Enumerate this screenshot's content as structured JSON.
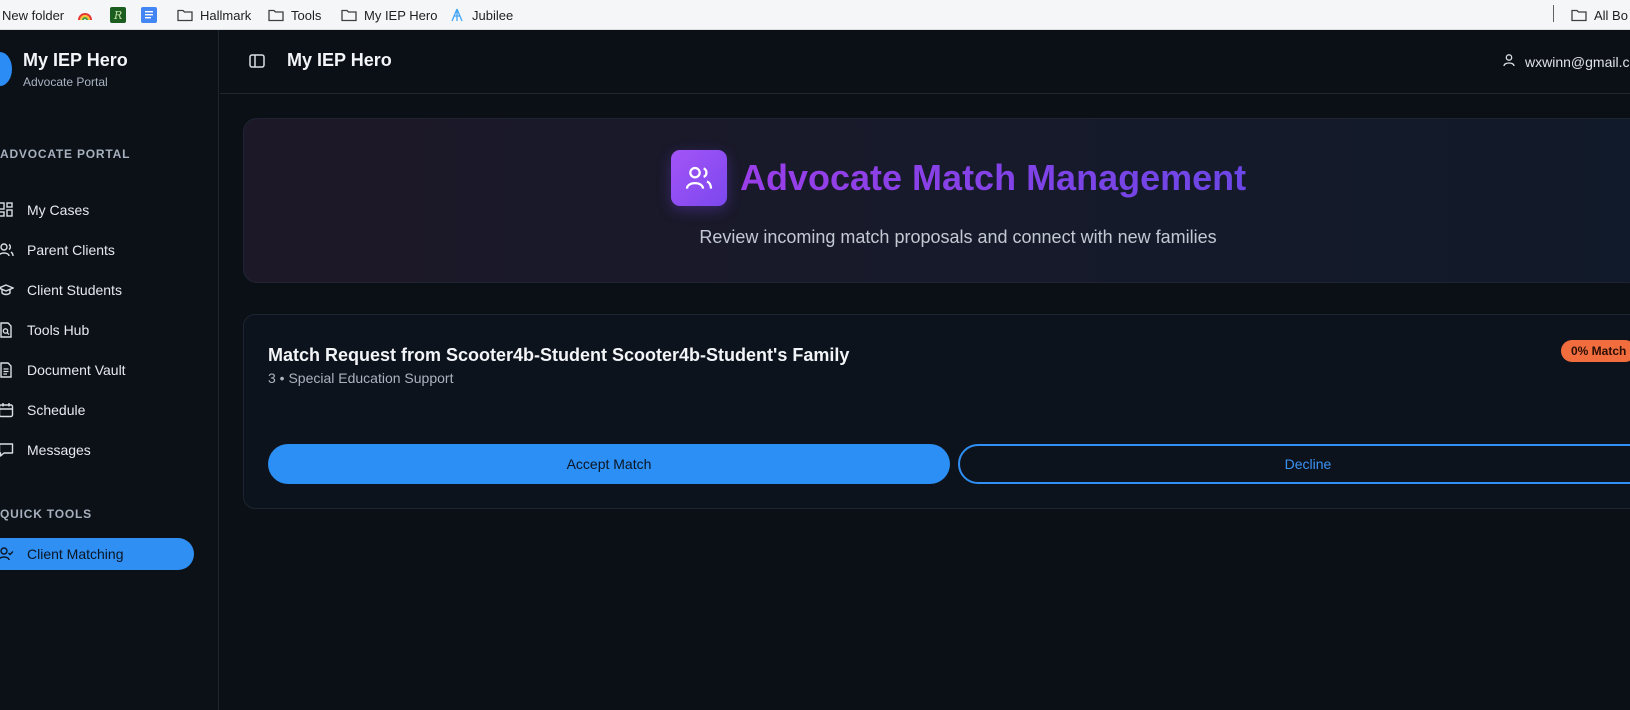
{
  "bookmarks": {
    "items": [
      {
        "label": "New folder",
        "icon": "folder-icon"
      },
      {
        "label": "",
        "icon": "rainbow-icon"
      },
      {
        "label": "",
        "icon": "r-logo-icon"
      },
      {
        "label": "",
        "icon": "docs-icon"
      },
      {
        "label": "Hallmark",
        "icon": "folder-icon"
      },
      {
        "label": "Tools",
        "icon": "folder-icon"
      },
      {
        "label": "My IEP Hero",
        "icon": "folder-icon"
      },
      {
        "label": "Jubilee",
        "icon": "jubilee-icon"
      },
      {
        "label": "All Bo",
        "icon": "folder-icon"
      }
    ]
  },
  "sidebar": {
    "brand_title": "My IEP Hero",
    "brand_subtitle": "Advocate Portal",
    "section_advocate": "ADVOCATE PORTAL",
    "items": [
      {
        "label": "My Cases",
        "icon": "grid-icon"
      },
      {
        "label": "Parent Clients",
        "icon": "users-icon"
      },
      {
        "label": "Client Students",
        "icon": "graduation-cap-icon"
      },
      {
        "label": "Tools Hub",
        "icon": "file-search-icon"
      },
      {
        "label": "Document Vault",
        "icon": "document-icon"
      },
      {
        "label": "Schedule",
        "icon": "calendar-icon"
      },
      {
        "label": "Messages",
        "icon": "message-icon"
      }
    ],
    "section_quick": "QUICK TOOLS",
    "quick_items": [
      {
        "label": "Client Matching",
        "icon": "user-check-icon",
        "active": true
      }
    ]
  },
  "header": {
    "title": "My IEP Hero",
    "user_email": "wxwinn@gmail.c"
  },
  "hero": {
    "title": "Advocate Match Management",
    "subtitle": "Review incoming match proposals and connect with new families"
  },
  "match_card": {
    "title": "Match Request from Scooter4b-Student Scooter4b-Student's Family",
    "subtitle": "3 • Special Education Support",
    "badge": "0% Match",
    "accept_label": "Accept Match",
    "decline_label": "Decline"
  },
  "colors": {
    "accent": "#2b8ff6",
    "badge": "#f26d3d",
    "hero_gradient_start": "#9a3ee8",
    "hero_gradient_end": "#6c46e6"
  }
}
